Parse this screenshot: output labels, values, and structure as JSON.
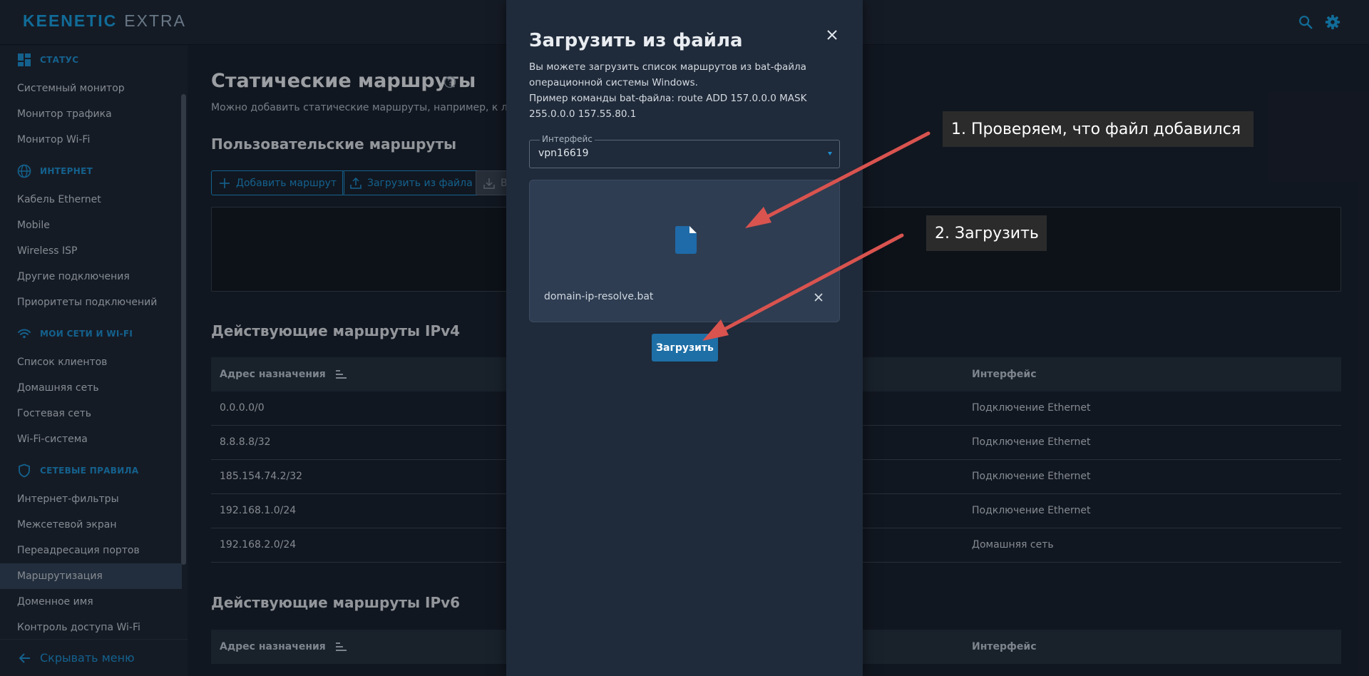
{
  "topbar": {
    "brand": "KEENETIC",
    "model": "EXTRA"
  },
  "sidebar": {
    "sections": [
      {
        "title": "СТАТУС",
        "icon": "dashboard-icon"
      },
      {
        "title": "ИНТЕРНЕТ",
        "icon": "globe-icon"
      },
      {
        "title": "МОИ СЕТИ И WI-FI",
        "icon": "wifi-icon"
      },
      {
        "title": "СЕТЕВЫЕ ПРАВИЛА",
        "icon": "shield-icon"
      }
    ],
    "items": [
      "Системный монитор",
      "Монитор трафика",
      "Монитор Wi-Fi",
      "Кабель Ethernet",
      "Mobile",
      "Wireless ISP",
      "Другие подключения",
      "Приоритеты подключений",
      "Список клиентов",
      "Домашняя сеть",
      "Гостевая сеть",
      "Wi-Fi-система",
      "Интернет-фильтры",
      "Межсетевой экран",
      "Переадресация портов",
      "Маршрутизация",
      "Доменное имя",
      "Контроль доступа Wi-Fi"
    ],
    "active_item": "Маршрутизация",
    "footer": "Скрывать меню"
  },
  "main": {
    "title": "Статические маршруты",
    "subtitle": "Можно добавить статические маршруты, например, к локальн",
    "user_routes_title": "Пользовательские маршруты",
    "add_route": "Добавить маршрут",
    "upload_from_file": "Загрузить из файла",
    "grey_button": "В",
    "ipv4_title": "Действующие маршруты IPv4",
    "ipv6_title": "Действующие маршруты IPv6",
    "col_dest": "Адрес назначения",
    "col_iface": "Интерфейс",
    "ipv4_rows": [
      {
        "dest": "0.0.0.0/0",
        "iface": "Подключение Ethernet"
      },
      {
        "dest": "8.8.8.8/32",
        "iface": "Подключение Ethernet"
      },
      {
        "dest": "185.154.74.2/32",
        "iface": "Подключение Ethernet"
      },
      {
        "dest": "192.168.1.0/24",
        "iface": "Подключение Ethernet"
      },
      {
        "dest": "192.168.2.0/24",
        "iface": "Домашняя сеть"
      }
    ]
  },
  "dialog": {
    "title": "Загрузить из файла",
    "text1": "Вы можете загрузить список маршрутов из bat-файла операционной системы Windows.",
    "text2": "Пример команды bat-файла: route ADD 157.0.0.0 MASK 255.0.0.0 157.55.80.1",
    "interface_label": "Интерфейс",
    "interface_value": "vpn16619",
    "file_name": "domain-ip-resolve.bat",
    "upload_button": "Загрузить"
  },
  "annotations": {
    "step1": "1. Проверяем, что файл добавился",
    "step2": "2. Загрузить",
    "color": "#d9534f"
  }
}
